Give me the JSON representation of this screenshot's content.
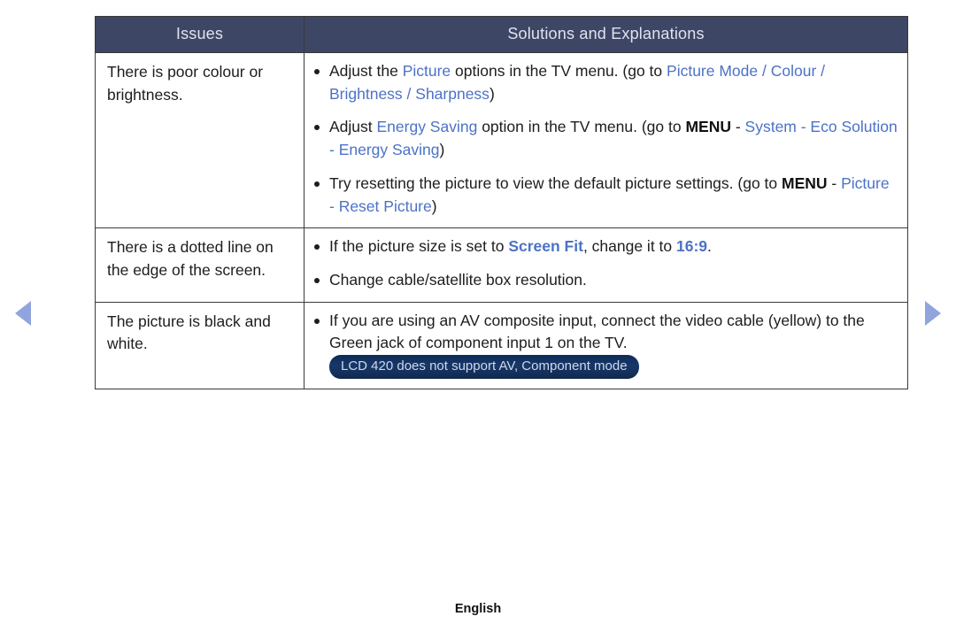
{
  "nav": {
    "prev_icon": "triangle-left-icon",
    "next_icon": "triangle-right-icon",
    "arrow_color": "#92a4dd"
  },
  "colors": {
    "header_bg": "#3e4665",
    "header_text": "#dfe3ef",
    "accent_blue": "#4c72c6",
    "badge_bg": "#12305c",
    "badge_text": "#cfd8e6",
    "border": "#3a3a3a",
    "body_text": "#1d1d1d"
  },
  "table": {
    "headers": {
      "issues": "Issues",
      "solutions": "Solutions and Explanations"
    },
    "rows": [
      {
        "issue": "There is poor colour or brightness.",
        "bullets": [
          {
            "parts": [
              {
                "t": "Adjust the ",
                "s": "plain"
              },
              {
                "t": "Picture",
                "s": "blue"
              },
              {
                "t": " options in the TV menu. (go to ",
                "s": "plain"
              },
              {
                "t": "Picture Mode / Colour / Brightness / Sharpness",
                "s": "blue"
              },
              {
                "t": ")",
                "s": "plain"
              }
            ]
          },
          {
            "parts": [
              {
                "t": "Adjust ",
                "s": "plain"
              },
              {
                "t": "Energy Saving",
                "s": "blue"
              },
              {
                "t": " option in the TV menu. (go to ",
                "s": "plain"
              },
              {
                "t": "MENU",
                "s": "bold-black"
              },
              {
                "t": " - ",
                "s": "plain"
              },
              {
                "t": "System - Eco Solution - Energy Saving",
                "s": "blue"
              },
              {
                "t": ")",
                "s": "plain"
              }
            ]
          },
          {
            "parts": [
              {
                "t": "Try resetting the picture to view the default picture settings. (go to ",
                "s": "plain"
              },
              {
                "t": "MENU",
                "s": "bold-black"
              },
              {
                "t": " - ",
                "s": "plain"
              },
              {
                "t": "Picture - Reset Picture",
                "s": "blue"
              },
              {
                "t": ")",
                "s": "plain"
              }
            ]
          }
        ]
      },
      {
        "issue": "There is a dotted line on the edge of the screen.",
        "bullets": [
          {
            "parts": [
              {
                "t": "If the picture size is set to ",
                "s": "plain"
              },
              {
                "t": "Screen Fit",
                "s": "blue-bold"
              },
              {
                "t": ", change it to ",
                "s": "plain"
              },
              {
                "t": "16:9",
                "s": "blue-bold"
              },
              {
                "t": ".",
                "s": "plain"
              }
            ]
          },
          {
            "parts": [
              {
                "t": "Change cable/satellite box resolution.",
                "s": "plain"
              }
            ]
          }
        ]
      },
      {
        "issue": "The picture is black and white.",
        "bullets": [
          {
            "parts": [
              {
                "t": "If you are using an AV composite input, connect the video cable (yellow) to the Green jack of component input 1 on the TV. ",
                "s": "plain"
              },
              {
                "t": "LCD 420 does not support AV, Component mode",
                "s": "badge"
              }
            ]
          }
        ]
      }
    ]
  },
  "footer": {
    "language": "English"
  }
}
